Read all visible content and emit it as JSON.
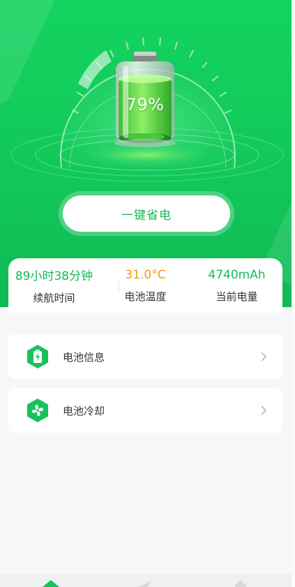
{
  "battery": {
    "percent_text": "79%",
    "percent": 79
  },
  "action": {
    "save_power_label": "一键省电"
  },
  "stats": [
    {
      "value": "89小时38分钟",
      "label": "续航时间"
    },
    {
      "value": "31.0°C",
      "label": "电池温度"
    },
    {
      "value": "4740mAh",
      "label": "当前电量"
    }
  ],
  "menu": [
    {
      "title": "电池信息",
      "icon": "battery-info-icon"
    },
    {
      "title": "电池冷却",
      "icon": "fan-icon"
    }
  ],
  "tabbar": {
    "icons": [
      "home-icon",
      "send-icon",
      "settings-icon"
    ]
  },
  "colors": {
    "brand_green": "#14d35f",
    "accent_green": "#17b957",
    "temperature_orange": "#f39b13"
  }
}
